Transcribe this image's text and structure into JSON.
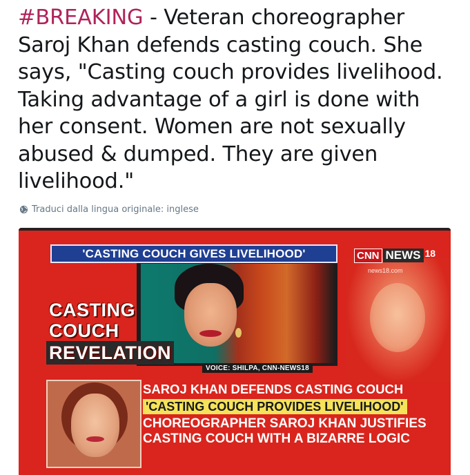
{
  "tweet": {
    "hashtag": "#BREAKING",
    "text": " - Veteran choreographer Saroj Khan defends casting couch. She says, \"Casting couch provides livelihood. Taking advantage of a girl is done with her consent. Women are not sexually abused & dumped. They are given livelihood.\"",
    "translate_label": "Traduci dalla lingua originale: inglese"
  },
  "media": {
    "top_banner": "'CASTING COUCH GIVES LIVELIHOOD'",
    "logo": {
      "cnn": "CNN",
      "news": "NEWS",
      "number": "18",
      "site": "news18.com"
    },
    "title_lines": [
      "CASTING",
      "COUCH",
      "REVELATION"
    ],
    "voice_credit": "VOICE: SHILPA, CNN-NEWS18",
    "ticker_line1": "SAROJ KHAN DEFENDS CASTING COUCH",
    "ticker_line2": "'CASTING COUCH PROVIDES LIVELIHOOD'",
    "ticker_line3": "CHOREOGRAPHER SAROJ KHAN JUSTIFIES CASTING COUCH WITH A BIZARRE LOGIC"
  },
  "colors": {
    "hashtag": "#b0235b",
    "text": "#14171a",
    "secondary_text": "#657786",
    "news_red": "#d9251d",
    "banner_blue": "#1f3f92",
    "highlight_yellow": "#f6e35a"
  }
}
